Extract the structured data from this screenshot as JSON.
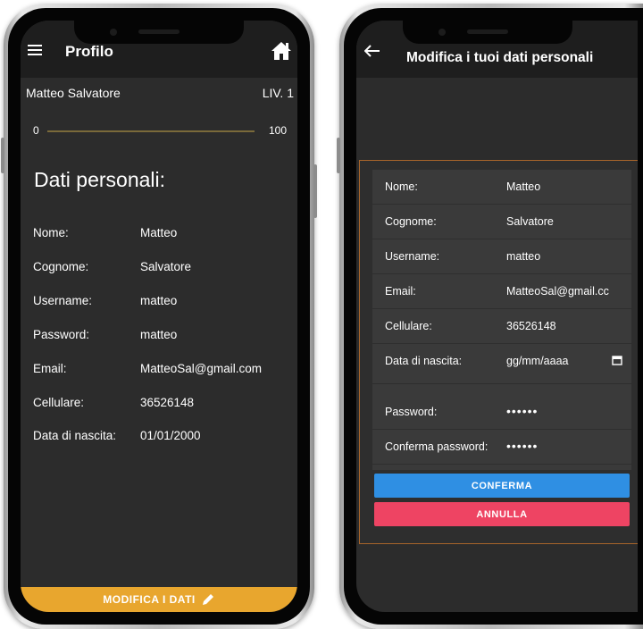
{
  "left_screen": {
    "header": {
      "title": "Profilo",
      "menu_icon": "menu-icon",
      "home_icon": "home-icon"
    },
    "user": {
      "name": "Matteo Salvatore",
      "level": "LIV. 1"
    },
    "progress": {
      "min": "0",
      "max": "100",
      "value": 0
    },
    "section_title": "Dati personali:",
    "fields": [
      {
        "label": "Nome:",
        "value": "Matteo"
      },
      {
        "label": "Cognome:",
        "value": "Salvatore"
      },
      {
        "label": "Username:",
        "value": "matteo"
      },
      {
        "label": "Password:",
        "value": "matteo"
      },
      {
        "label": "Email:",
        "value": "MatteoSal@gmail.com"
      },
      {
        "label": "Cellulare:",
        "value": "36526148"
      },
      {
        "label": "Data di nascita:",
        "value": "01/01/2000"
      }
    ],
    "bottom_button": {
      "label": "MODIFICA I DATI",
      "icon": "pencil-icon"
    }
  },
  "right_screen": {
    "header": {
      "title": "Modifica i tuoi dati personali",
      "back_icon": "back-arrow-icon"
    },
    "form": [
      {
        "label": "Nome:",
        "value": "Matteo"
      },
      {
        "label": "Cognome:",
        "value": "Salvatore"
      },
      {
        "label": "Username:",
        "value": "matteo"
      },
      {
        "label": "Email:",
        "value": "MatteoSal@gmail.cc"
      },
      {
        "label": "Cellulare:",
        "value": "36526148"
      },
      {
        "label": "Data di nascita:",
        "value": "gg/mm/aaaa"
      },
      {
        "label": "Password:",
        "value": "••••••"
      },
      {
        "label": "Conferma password:",
        "value": "••••••"
      }
    ],
    "confirm_label": "CONFERMA",
    "cancel_label": "ANNULLA"
  },
  "colors": {
    "accent_orange": "#e8a62e",
    "confirm_blue": "#2f8fe3",
    "cancel_red": "#ee4463",
    "screen_bg": "#2c2c2c",
    "appbar_bg": "#1e1e1e",
    "panel_border": "#a8652a"
  }
}
